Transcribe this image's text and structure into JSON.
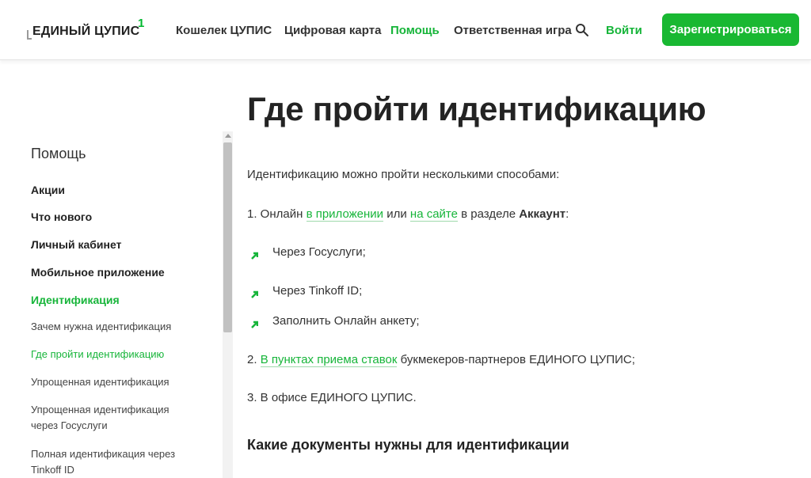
{
  "header": {
    "logo_text": "ЕДИНЫЙ ЦУПИС",
    "logo_sup": "1",
    "nav": [
      "Кошелек ЦУПИС",
      "Цифровая карта",
      "Помощь",
      "Ответственная игра"
    ],
    "login": "Войти",
    "register": "Зарегистрироваться"
  },
  "sidebar": {
    "title": "Помощь",
    "items": [
      "Акции",
      "Что нового",
      "Личный кабинет",
      "Мобильное приложение",
      "Идентификация"
    ],
    "sub_items": [
      "Зачем нужна идентификация",
      "Где пройти идентификацию",
      "Упрощенная идентификация",
      "Упрощенная идентификация через Госуслуги",
      "Полная идентификация через Tinkoff ID"
    ]
  },
  "content": {
    "title": "Где пройти идентификацию",
    "intro": "Идентификацию можно пройти несколькими способами:",
    "p1": {
      "a": "1. Онлайн ",
      "link1": "в приложении",
      "b": " или ",
      "link2": "на сайте",
      "c": " в разделе ",
      "bold": "Аккаунт",
      "d": ":"
    },
    "bullets": [
      "Через Госуслуги;",
      "Через Tinkoff ID;",
      "Заполнить Онлайн анкету;"
    ],
    "p2": {
      "a": "2. ",
      "link": "В пунктах приема ставок",
      "b": " букмекеров-партнеров ЕДИНОГО ЦУПИС;"
    },
    "p3": "3. В офисе ЕДИНОГО ЦУПИС.",
    "subtitle": "Какие документы нужны для идентификации"
  },
  "colors": {
    "accent": "#17b53a",
    "button": "#19b832"
  }
}
